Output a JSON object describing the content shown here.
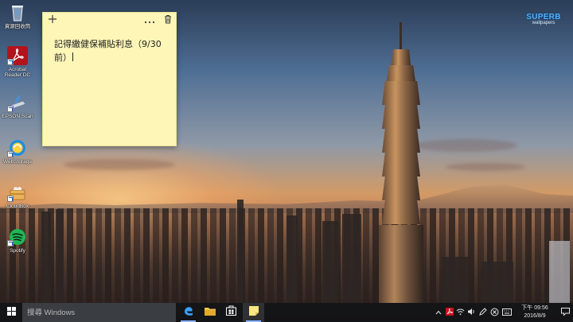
{
  "desktop": {
    "watermark": {
      "line1": "SUPERB",
      "line2": "wallpapers"
    },
    "icons": [
      {
        "label": "資源回收筒",
        "icon": "recycle-bin-icon"
      },
      {
        "label": "Acrobat Reader DC",
        "icon": "acrobat-icon"
      },
      {
        "label": "EPSON Scan",
        "icon": "epson-scan-icon"
      },
      {
        "label": "WebStorage",
        "icon": "webstorage-icon"
      },
      {
        "label": "CloudBox",
        "icon": "cloudbox-icon"
      },
      {
        "label": "Spotify",
        "icon": "spotify-icon"
      }
    ]
  },
  "sticky_note": {
    "text": "記得繳健保補貼利息（9/30前）",
    "line1": "記得繳健保補貼利息（9/30",
    "line2": "前）",
    "colors": {
      "background": "#fdf6b7"
    },
    "icons": {
      "add": "plus-icon",
      "menu": "ellipsis-icon",
      "delete": "trash-icon"
    }
  },
  "taskbar": {
    "search_placeholder": "搜尋 Windows",
    "apps": [
      "edge-icon",
      "file-explorer-icon",
      "store-icon",
      "sticky-notes-icon"
    ],
    "tray": {
      "icons": [
        "chevron-up-icon",
        "acrobat-tray-icon",
        "wifi-icon",
        "volume-icon",
        "pen-icon",
        "sync-icon",
        "keyboard-icon"
      ]
    },
    "clock": {
      "time": "下午 09:56",
      "date": "2016/8/9"
    }
  }
}
